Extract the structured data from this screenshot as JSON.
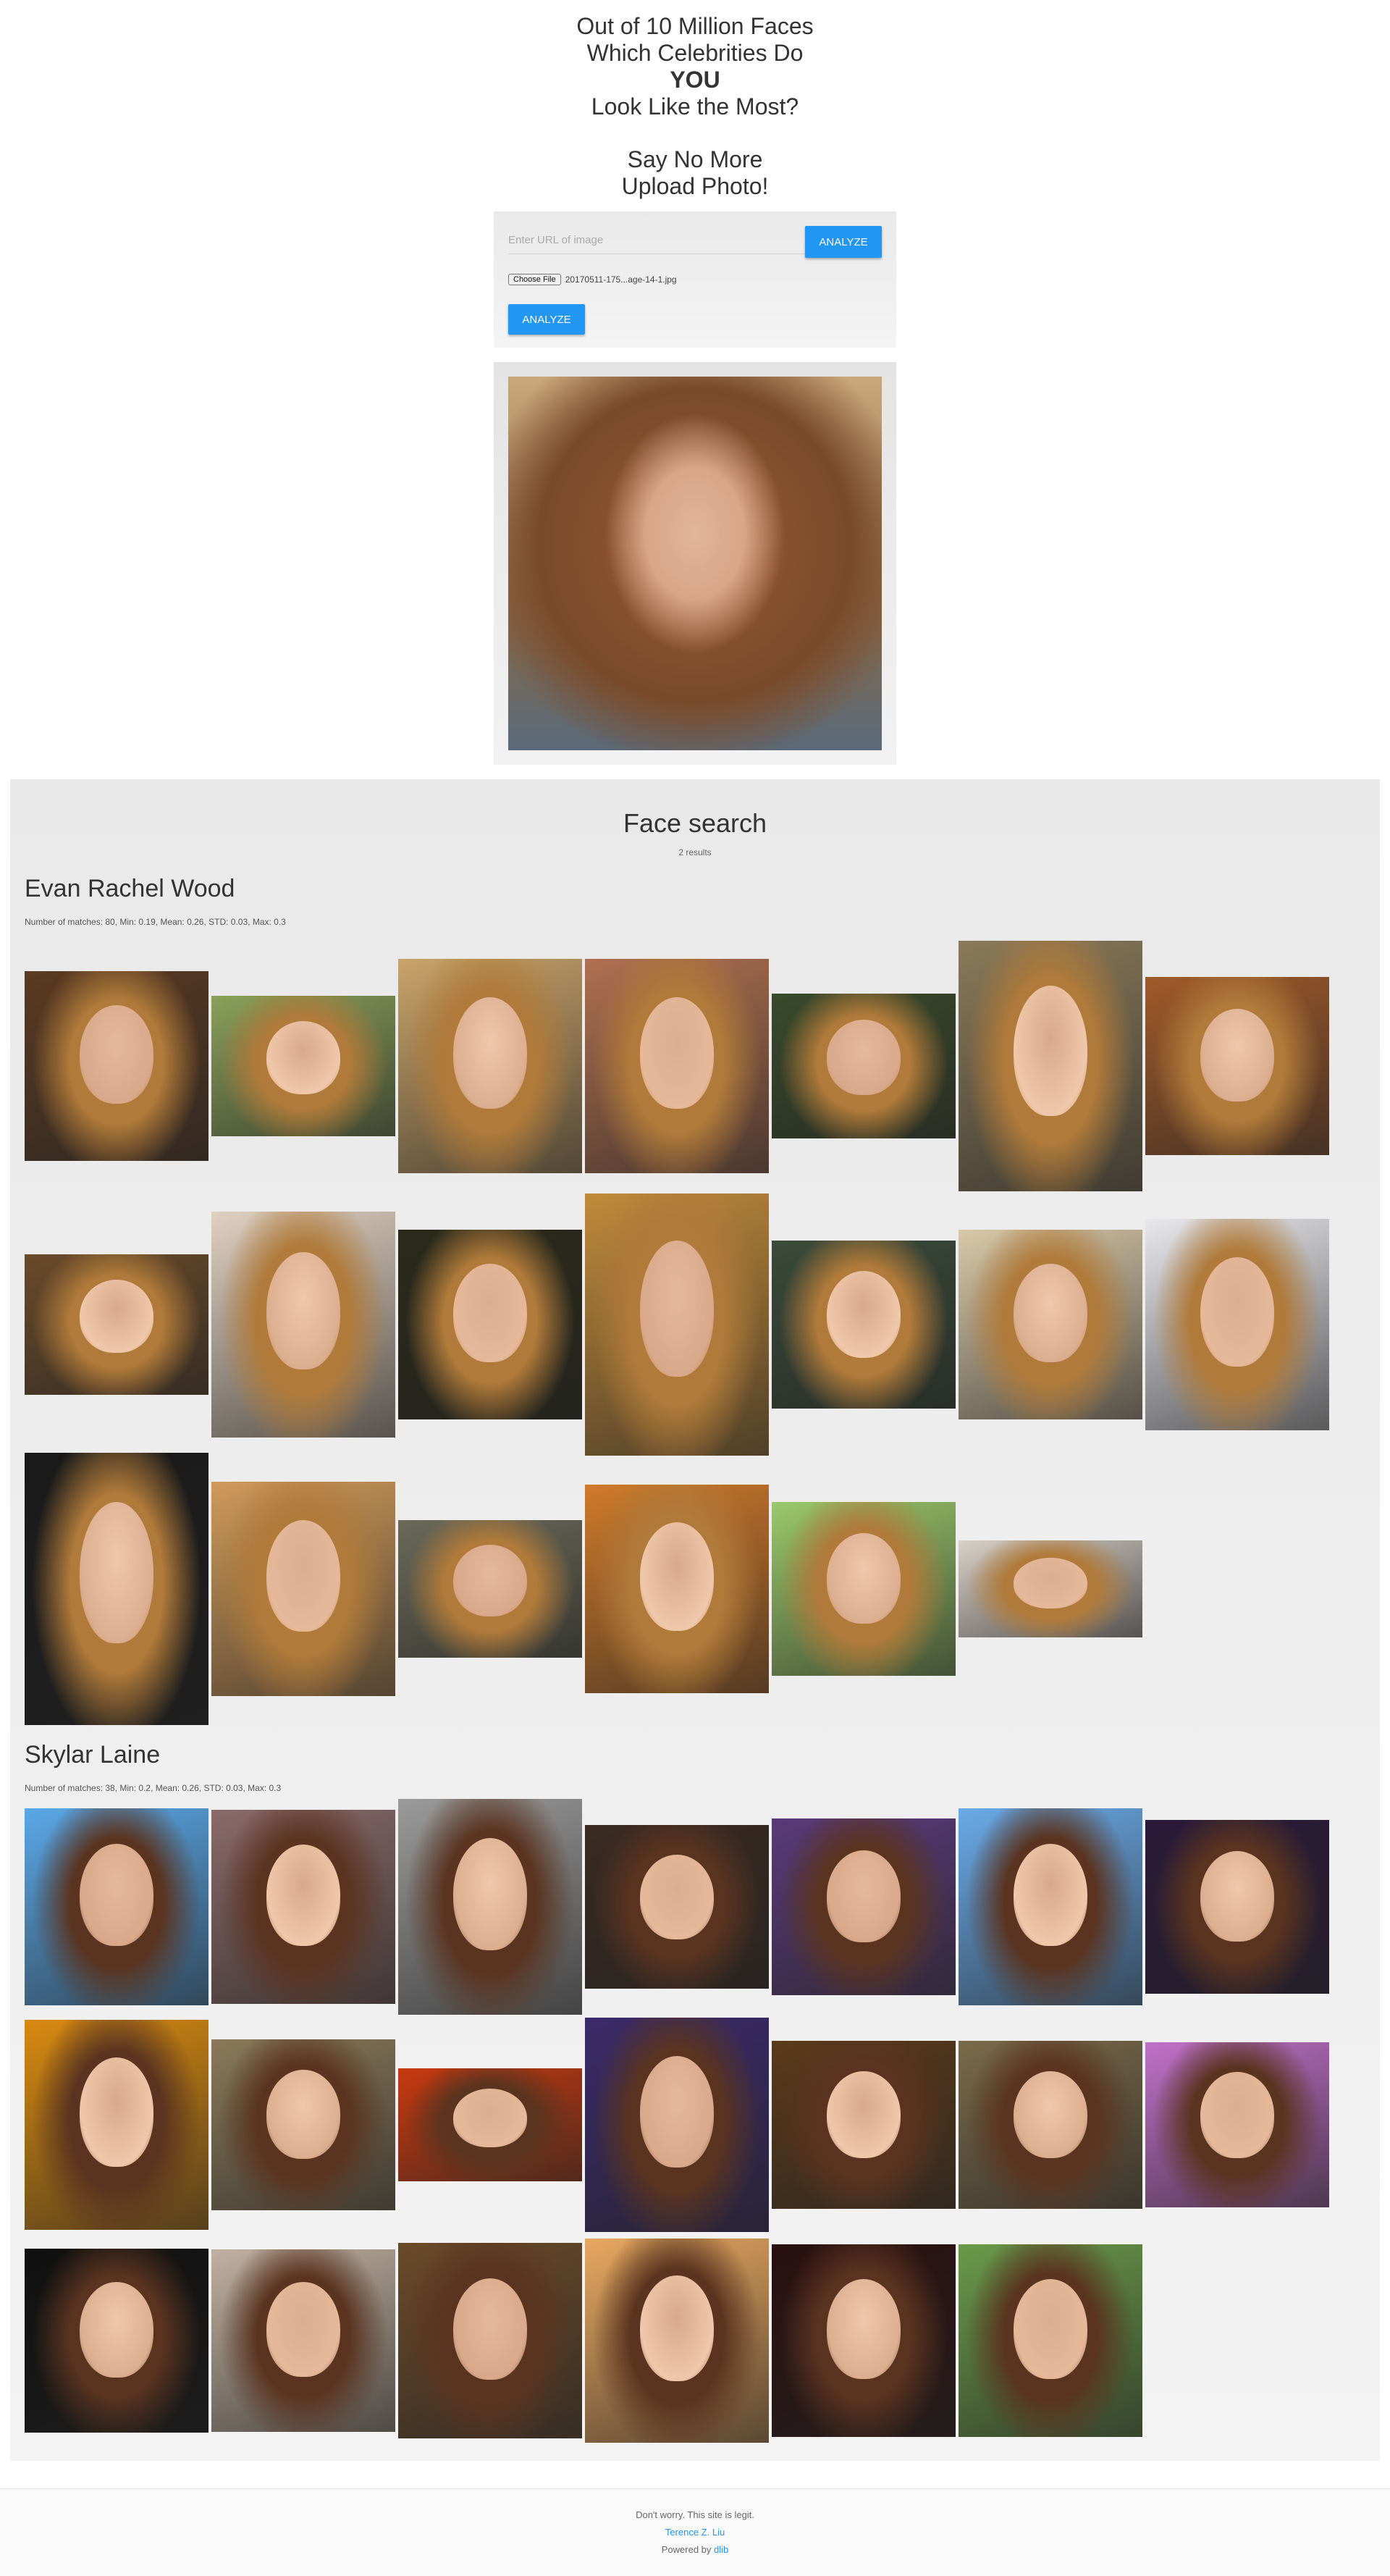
{
  "hero": {
    "line1": "Out of 10 Million Faces",
    "line2": "Which Celebrities Do",
    "line3": "YOU",
    "line4": "Look Like the Most?",
    "line5": "Say No More",
    "line6": "Upload Photo!"
  },
  "upload": {
    "url_placeholder": "Enter URL of image",
    "url_value": "",
    "analyze_label": "ANALYZE",
    "choose_file_label": "Choose File",
    "file_name": "20170511-175...age-14-1.jpg",
    "file_analyze_label": "ANALYZE"
  },
  "results": {
    "title": "Face search",
    "count": "2 results",
    "celebrities": [
      {
        "name": "Evan Rachel Wood",
        "stats": "Number of matches: 80, Min: 0.19, Mean: 0.26, STD: 0.03, Max: 0.3",
        "image_count": 20
      },
      {
        "name": "Skylar Laine",
        "stats": "Number of matches: 38, Min: 0.2, Mean: 0.26, STD: 0.03, Max: 0.3",
        "image_count": 20
      }
    ]
  },
  "footer": {
    "line1": "Don't worry. This site is legit.",
    "author_link": "Terence Z. Liu",
    "powered_prefix": "Powered by ",
    "powered_link": "dlib"
  },
  "colors": {
    "accent": "#2196f3",
    "results_bg": "#ececec"
  }
}
